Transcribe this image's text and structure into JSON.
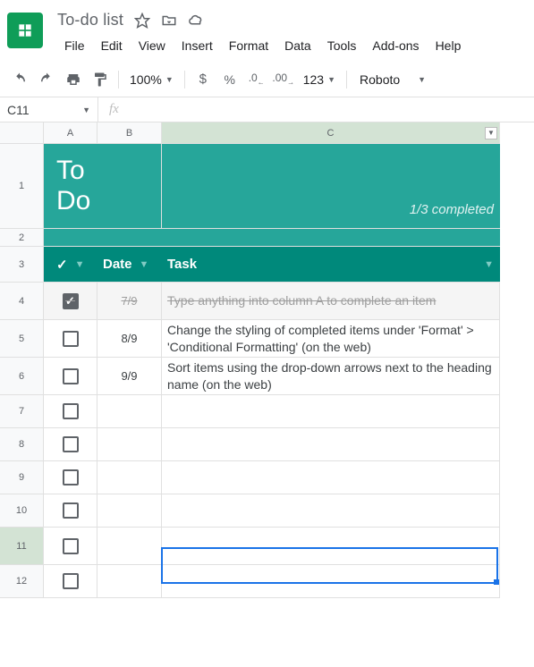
{
  "doc": {
    "title": "To-do list"
  },
  "menu": {
    "file": "File",
    "edit": "Edit",
    "view": "View",
    "insert": "Insert",
    "format": "Format",
    "data": "Data",
    "tools": "Tools",
    "addons": "Add-ons",
    "help": "Help"
  },
  "toolbar": {
    "zoom": "100%",
    "currency": "$",
    "percent": "%",
    "decDec": ".0",
    "incDec": ".00",
    "numFormat": "123",
    "font": "Roboto"
  },
  "nameBox": "C11",
  "cols": {
    "a": "A",
    "b": "B",
    "c": "C"
  },
  "rows": [
    "1",
    "2",
    "3",
    "4",
    "5",
    "6",
    "7",
    "8",
    "9",
    "10",
    "11",
    "12"
  ],
  "sheet": {
    "title": "To Do",
    "progress": "1/3 completed",
    "headers": {
      "check": "✓",
      "date": "Date",
      "task": "Task"
    },
    "items": [
      {
        "done": true,
        "date": "7/9",
        "task": "Type anything into column A to complete an item"
      },
      {
        "done": false,
        "date": "8/9",
        "task": "Change the styling of completed items under 'Format' > 'Conditional Formatting' (on the web)"
      },
      {
        "done": false,
        "date": "9/9",
        "task": "Sort items using the drop-down arrows next to the heading name (on the web)"
      },
      {
        "done": false,
        "date": "",
        "task": ""
      },
      {
        "done": false,
        "date": "",
        "task": ""
      },
      {
        "done": false,
        "date": "",
        "task": ""
      },
      {
        "done": false,
        "date": "",
        "task": ""
      },
      {
        "done": false,
        "date": "",
        "task": ""
      },
      {
        "done": false,
        "date": "",
        "task": ""
      }
    ]
  }
}
